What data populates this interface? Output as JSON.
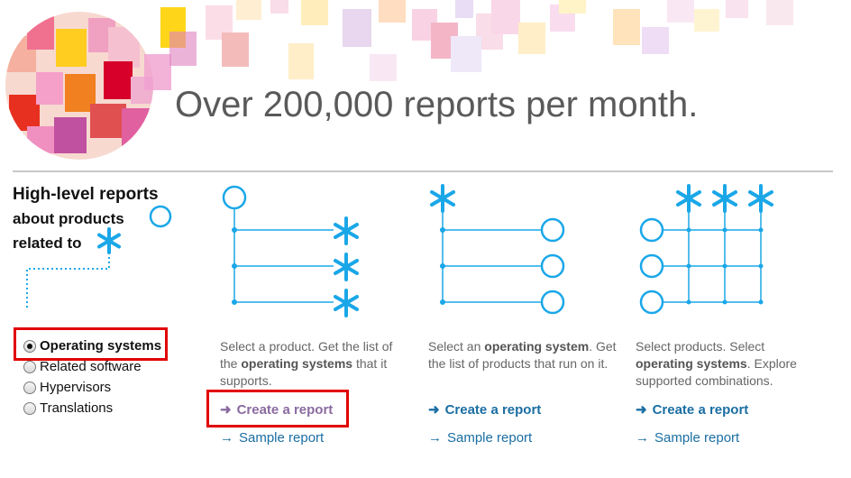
{
  "banner": {
    "headline": "Over 200,000 reports per month."
  },
  "sidebar": {
    "title_line1": "High-level reports",
    "title_line2": "about products",
    "title_line3": "related to",
    "options": [
      {
        "label": "Operating systems",
        "selected": true
      },
      {
        "label": "Related software",
        "selected": false
      },
      {
        "label": "Hypervisors",
        "selected": false
      },
      {
        "label": "Translations",
        "selected": false
      }
    ]
  },
  "columns": [
    {
      "desc_parts": [
        "Select a product. Get the list of the ",
        "operating systems",
        " that it supports."
      ],
      "create_label": "Create a report",
      "sample_label": "Sample report"
    },
    {
      "desc_parts": [
        "Select an ",
        "operating system",
        ". Get the list of products that run on it."
      ],
      "create_label": "Create a report",
      "sample_label": "Sample report"
    },
    {
      "desc_parts": [
        "Select products. Select ",
        "operating systems",
        ". Explore supported combinations."
      ],
      "create_label": "Create a report",
      "sample_label": "Sample report"
    }
  ],
  "colors": {
    "accent_blue": "#1aa7e8",
    "link_blue": "#1a6ea3",
    "visited_link": "#8a6ba0",
    "highlight_red": "#e10000"
  },
  "icons": [
    "product-circle-icon",
    "os-asterisk-icon",
    "arrow-right-icon"
  ]
}
